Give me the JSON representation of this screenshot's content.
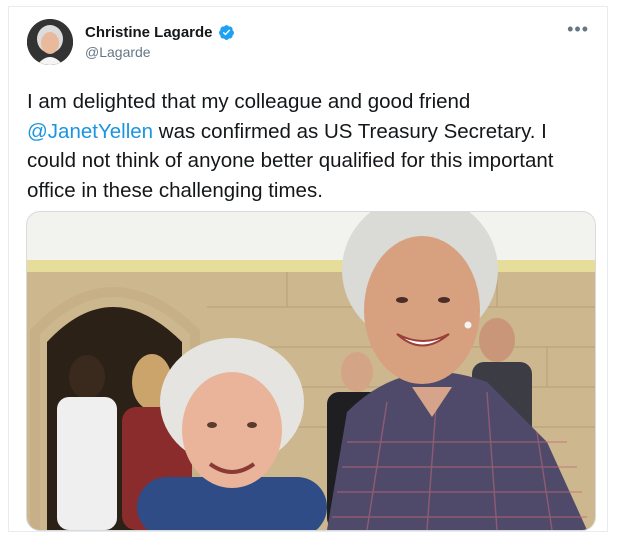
{
  "tweet": {
    "author_name": "Christine Lagarde",
    "author_handle": "@Lagarde",
    "more_label": "•••",
    "text_part1": "I am delighted that my colleague and good friend ",
    "mention": "@JanetYellen",
    "text_part2": " was confirmed as US Treasury Secretary. I could not think of anyone better qualified for this important office in these challenging times.",
    "verified_color": "#1da1f2",
    "mention_color": "#1b95e0"
  },
  "icons": {
    "verified": "verified-badge-icon",
    "more": "more-options-icon"
  }
}
